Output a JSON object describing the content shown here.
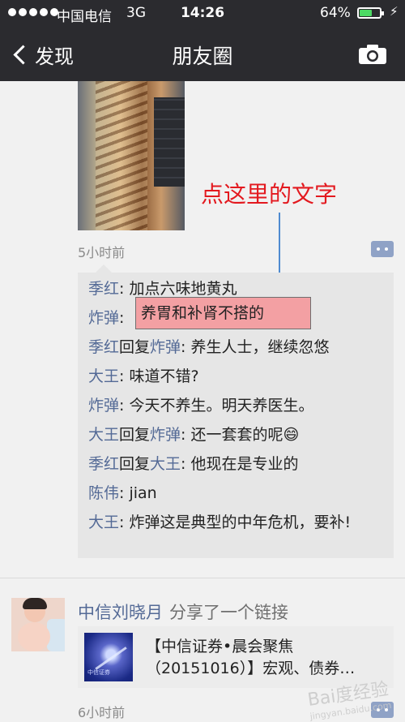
{
  "status_bar": {
    "carrier": "中国电信",
    "network": "3G",
    "time": "14:26",
    "battery_percent": "64%",
    "battery_level": 0.64
  },
  "nav": {
    "back_label": "发现",
    "title": "朋友圈",
    "camera_icon": "camera-icon"
  },
  "post1": {
    "time": "5小时前",
    "annotation": "点这里的文字",
    "highlight_text": "养胃和补肾不搭的",
    "comments": [
      {
        "parts": [
          {
            "t": "季红",
            "name": true
          },
          {
            "t": ": 加点六味地黄丸",
            "name": false
          }
        ]
      },
      {
        "parts": [
          {
            "t": "炸弹",
            "name": true
          },
          {
            "t": ":",
            "name": false
          }
        ]
      },
      {
        "parts": [
          {
            "t": "季红",
            "name": true
          },
          {
            "t": "回复",
            "name": false
          },
          {
            "t": "炸弹",
            "name": true
          },
          {
            "t": ": 养生人士，继续忽悠",
            "name": false
          }
        ]
      },
      {
        "parts": [
          {
            "t": "大王",
            "name": true
          },
          {
            "t": ": 味道不错?",
            "name": false
          }
        ]
      },
      {
        "parts": [
          {
            "t": "炸弹",
            "name": true
          },
          {
            "t": ": 今天不养生。明天养医生。",
            "name": false
          }
        ]
      },
      {
        "parts": [
          {
            "t": "大王",
            "name": true
          },
          {
            "t": "回复",
            "name": false
          },
          {
            "t": "炸弹",
            "name": true
          },
          {
            "t": ": 还一套套的呢😄",
            "name": false
          }
        ]
      },
      {
        "parts": [
          {
            "t": "季红",
            "name": true
          },
          {
            "t": "回复",
            "name": false
          },
          {
            "t": "大王",
            "name": true
          },
          {
            "t": ": 他现在是专业的",
            "name": false
          }
        ]
      },
      {
        "parts": [
          {
            "t": "陈伟",
            "name": true
          },
          {
            "t": ": jian",
            "name": false
          }
        ]
      },
      {
        "parts": [
          {
            "t": "大王",
            "name": true
          },
          {
            "t": ": 炸弹这是典型的中年危机，要补!",
            "name": false
          }
        ]
      }
    ]
  },
  "post2": {
    "author": "中信刘晓月",
    "action": "分享了一个链接",
    "link_title": "【中信证券•晨会聚焦（20151016）】宏观、债券…",
    "thumb_label": "中信证券",
    "time": "6小时前"
  },
  "watermark": {
    "text": "Bai度经验",
    "sub": "jingyan.baidu.com"
  }
}
